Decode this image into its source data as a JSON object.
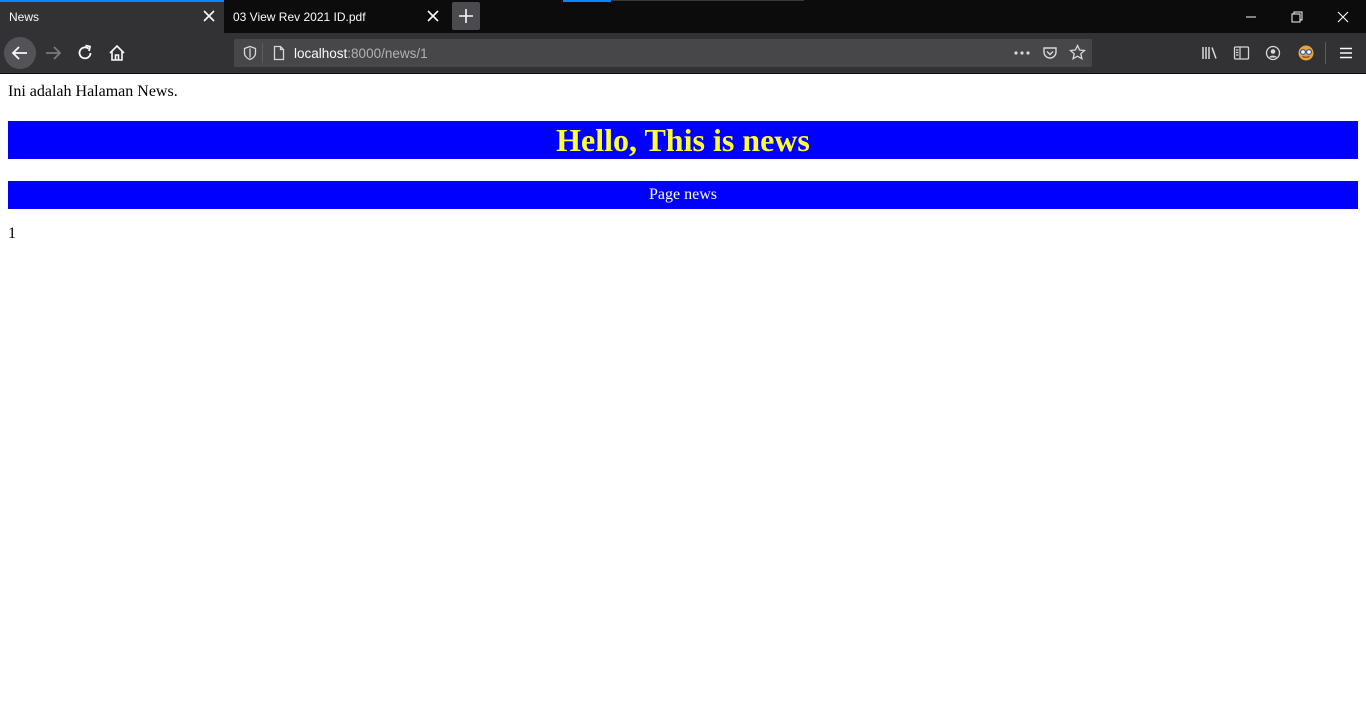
{
  "browser": {
    "tabs": [
      {
        "title": "News",
        "active": true
      },
      {
        "title": "03 View Rev 2021 ID.pdf",
        "active": false
      }
    ],
    "url": {
      "host": "localhost",
      "rest": ":8000/news/1"
    },
    "colors": {
      "accent": "#0a84ff",
      "toolbar": "#323234",
      "tabstrip": "#0c0c0d"
    }
  },
  "page": {
    "intro": "Ini adalah Halaman News.",
    "headline": "Hello, This is news",
    "subheading": "Page news",
    "id_value": "1",
    "colors": {
      "banner_bg": "#0000ff",
      "headline_text": "#ffff33",
      "subheading_text": "#ffffff"
    }
  }
}
